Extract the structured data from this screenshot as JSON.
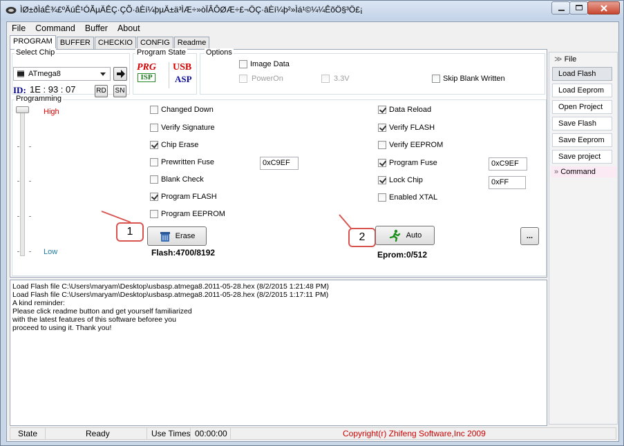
{
  "window": {
    "title": "ÌØ±ðÌáÊ¾£ºÄúÊ¹ÓÃµÄÊÇ·ÇÕ·âÈí¼þµÄ±ä³ÌÆ÷»òÏÂÔØÆ÷£¬ÖÇ·âÈí¼þ²»Ìá¹©¼¼ÊõÖ§³Ö£¡"
  },
  "menu": [
    "File",
    "Command",
    "Buffer",
    "About"
  ],
  "tabs": [
    "PROGRAM",
    "BUFFER",
    "CHECKIO",
    "CONFIG",
    "Readme"
  ],
  "select_chip": {
    "label": "Select Chip",
    "chip": "ATmega8",
    "id_label": "ID:",
    "id_value": "1E : 93 : 07",
    "rd": "RD",
    "sn": "SN"
  },
  "program_state": {
    "label": "Program State",
    "prg": "PRG",
    "isp": "ISP",
    "usb": "USB",
    "asp": "ASP"
  },
  "options": {
    "label": "Options",
    "image_data": "Image Data",
    "power_on": "PowerOn",
    "v33": "3.3V",
    "skip_blank": "Skip Blank Written"
  },
  "programming": {
    "label": "Programming",
    "high": "High",
    "low": "Low",
    "left_checks": [
      {
        "label": "Changed Down",
        "checked": false
      },
      {
        "label": "Verify Signature",
        "checked": false
      },
      {
        "label": "Chip Erase",
        "checked": true
      },
      {
        "label": "Prewritten Fuse",
        "checked": false
      },
      {
        "label": "Blank Check",
        "checked": false
      },
      {
        "label": "Program FLASH",
        "checked": true
      },
      {
        "label": "Program EEPROM",
        "checked": false
      }
    ],
    "right_checks": [
      {
        "label": "Data Reload",
        "checked": true
      },
      {
        "label": "Verify FLASH",
        "checked": true
      },
      {
        "label": "Verify EEPROM",
        "checked": false
      },
      {
        "label": "Program Fuse",
        "checked": true
      },
      {
        "label": "Lock Chip",
        "checked": true
      },
      {
        "label": "Enabled XTAL",
        "checked": false
      }
    ],
    "prewritten_fuse_value": "0xC9EF",
    "program_fuse_value": "0xC9EF",
    "lock_chip_value": "0xFF",
    "erase_label": "Erase",
    "auto_label": "Auto",
    "more_label": "...",
    "flash_counter": "Flash:4700/8192",
    "eprom_counter": "Eprom:0/512",
    "callout1": "1",
    "callout2": "2"
  },
  "log": [
    "Load Flash file C:\\Users\\maryam\\Desktop\\usbasp.atmega8.2011-05-28.hex (8/2/2015 1:21:48 PM)",
    "Load Flash file C:\\Users\\maryam\\Desktop\\usbasp.atmega8.2011-05-28.hex (8/2/2015 1:17:11 PM)",
    "A kind reminder:",
    "Please click readme button and get yourself familiarized",
    "with the latest features of this software beforee you",
    "proceed to using it. Thank you!"
  ],
  "status": {
    "state_label": "State",
    "state_value": "Ready",
    "use_times_label": "Use Times",
    "use_times_value": "00:00:00",
    "copyright": "Copyright(r) Zhifeng Software,Inc 2009"
  },
  "sidebar": {
    "file_head": "File",
    "buttons": [
      "Load Flash",
      "Load Eeprom",
      "Open Project",
      "Save Flash",
      "Save Eeprom",
      "Save project"
    ],
    "command_head": "Command"
  },
  "colors": {
    "red_text": "#e00000",
    "blue_id": "#00008b",
    "copyright": "#cc0000"
  }
}
